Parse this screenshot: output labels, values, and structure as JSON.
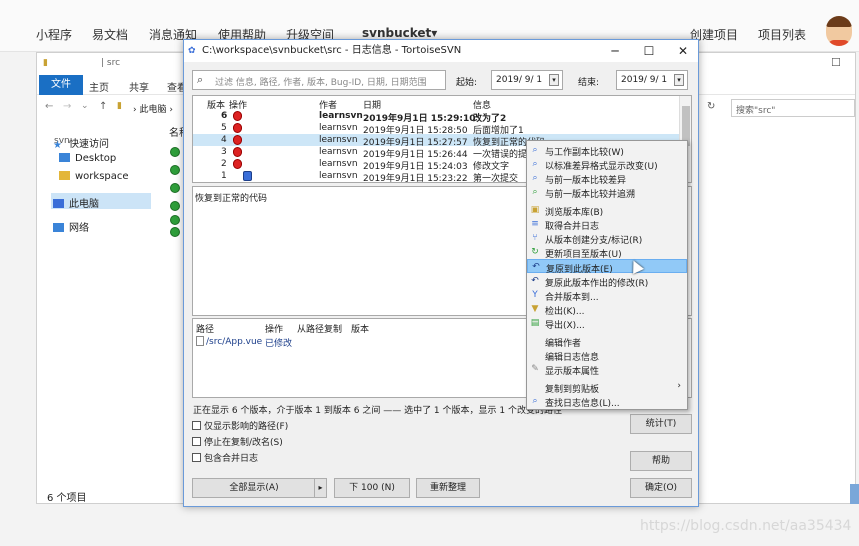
{
  "webnav": {
    "items": [
      "小程序",
      "易文档",
      "消息通知",
      "使用帮助",
      "升级空间"
    ],
    "brand": "svnbucket▾",
    "right_items": [
      "创建项目",
      "项目列表"
    ]
  },
  "explorer": {
    "path": "src",
    "ribbon": {
      "file": "文件",
      "tabs": [
        "主页",
        "共享",
        "查看"
      ]
    },
    "address": "此电脑",
    "search_placeholder": "搜索\"src\"",
    "column_name": "名称",
    "side": [
      "快速访问",
      "Desktop",
      "workspace",
      "此电脑",
      "网络"
    ],
    "left_label": "svn",
    "status": "6 个项目"
  },
  "dialog": {
    "title": "C:\\workspace\\svnbucket\\src - 日志信息 - TortoiseSVN",
    "filter_placeholder": "过滤 信息, 路径, 作者, 版本, Bug-ID, 日期, 日期范围",
    "from_label": "起始:",
    "to_label": "结束:",
    "from_date": "2019/ 9/ 1",
    "to_date": "2019/ 9/ 1",
    "columns": {
      "rev": "版本",
      "action": "操作",
      "author": "作者",
      "date": "日期",
      "msg": "信息"
    },
    "rows": [
      {
        "rev": "6",
        "author": "learnsvn",
        "date": "2019年9月1日 15:29:10",
        "msg": "改为了2",
        "bold": true
      },
      {
        "rev": "5",
        "author": "learnsvn",
        "date": "2019年9月1日 15:28:50",
        "msg": "后面增加了1"
      },
      {
        "rev": "4",
        "author": "learnsvn",
        "date": "2019年9月1日 15:27:57",
        "msg": "恢复到正常的代码",
        "selected": true
      },
      {
        "rev": "3",
        "author": "learnsvn",
        "date": "2019年9月1日 15:26:44",
        "msg": "一次错误的提交"
      },
      {
        "rev": "2",
        "author": "learnsvn",
        "date": "2019年9月1日 15:24:03",
        "msg": "修改文字"
      },
      {
        "rev": "1",
        "author": "learnsvn",
        "date": "2019年9月1日 15:23:22",
        "msg": "第一次提交"
      }
    ],
    "message": "恢复到正常的代码",
    "paths_columns": {
      "path": "路径",
      "action": "操作",
      "copyfrom": "从路径复制",
      "rev": "版本"
    },
    "paths_rows": [
      {
        "path": "/src/App.vue",
        "action": "已修改"
      }
    ],
    "status_line": "正在显示 6 个版本，介于版本 1 到版本 6 之间 —— 选中了 1 个版本，显示 1 个改变的路径",
    "checks": [
      "仅显示影响的路径(F)",
      "停止在复制/改名(S)",
      "包含合并日志"
    ],
    "buttons": {
      "show_all": "全部显示(A)",
      "next100": "下 100 (N)",
      "refresh": "重新整理",
      "stats": "统计(T)",
      "help": "帮助",
      "ok": "确定(O)"
    }
  },
  "context_menu": {
    "items": [
      {
        "label": "与工作副本比较(W)",
        "icon": "compare-icon"
      },
      {
        "label": "以标准差异格式显示改变(U)",
        "icon": "diff-icon"
      },
      {
        "label": "与前一版本比较差异",
        "icon": "compare-prev-icon"
      },
      {
        "label": "与前一版本比较并追溯",
        "icon": "blame-icon"
      },
      {
        "label": "浏览版本库(B)",
        "icon": "repo-browser-icon"
      },
      {
        "label": "取得合并日志",
        "icon": "merge-log-icon"
      },
      {
        "label": "从版本创建分支/标记(R)",
        "icon": "branch-icon"
      },
      {
        "label": "更新项目至版本(U)",
        "icon": "update-icon"
      },
      {
        "label": "复原到此版本(E)",
        "icon": "revert-icon",
        "highlighted": true
      },
      {
        "label": "复原此版本作出的修改(R)",
        "icon": "revert-changes-icon"
      },
      {
        "label": "合并版本到...",
        "icon": "merge-icon"
      },
      {
        "label": "检出(K)...",
        "icon": "checkout-icon"
      },
      {
        "label": "导出(X)...",
        "icon": "export-icon"
      },
      {
        "label": "编辑作者",
        "icon": ""
      },
      {
        "label": "编辑日志信息",
        "icon": ""
      },
      {
        "label": "显示版本属性",
        "icon": "properties-icon"
      },
      {
        "label": "复制到剪贴板",
        "icon": "",
        "submenu": true
      },
      {
        "label": "查找日志信息(L)...",
        "icon": "find-icon"
      }
    ]
  },
  "watermark": "https://blog.csdn.net/aa35434"
}
